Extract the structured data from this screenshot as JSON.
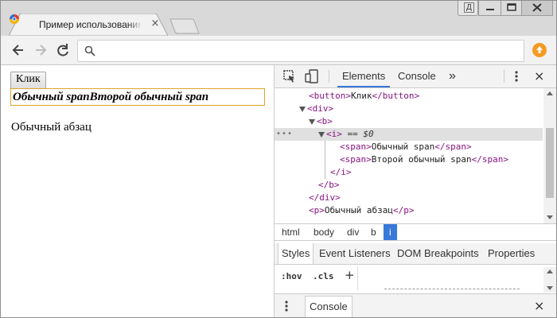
{
  "browser": {
    "tab_title": "Пример использования jQuery",
    "tab_close": "×",
    "omnibox_value": "",
    "user_badge": "Д"
  },
  "page": {
    "button_label": "Клик",
    "b_text": "Обычный spanВторой обычный span",
    "p_text": "Обычный абзац"
  },
  "devtools": {
    "tabs": [
      "Elements",
      "Console"
    ],
    "more": "»",
    "close": "×",
    "dom_lines": [
      {
        "open": "<button>",
        "text": "Клик",
        "close": "</button>"
      },
      {
        "open": "<div>",
        "text": "",
        "close": ""
      },
      {
        "open": "<b>",
        "text": "",
        "close": ""
      },
      {
        "open": "<i>",
        "text": "",
        "close": ""
      },
      {
        "open": "<span>",
        "text": "Обычный span",
        "close": "</span>"
      },
      {
        "open": "<span>",
        "text": "Второй обычный span",
        "close": "</span>"
      },
      {
        "open": "",
        "text": "",
        "close": "</i>"
      },
      {
        "open": "",
        "text": "",
        "close": "</b>"
      },
      {
        "open": "",
        "text": "",
        "close": "</div>"
      },
      {
        "open": "<p>",
        "text": "Обычный абзац",
        "close": "</p>"
      }
    ],
    "selected_marker": "== $0",
    "dots": "•••",
    "breadcrumbs": [
      "html",
      "body",
      "div",
      "b",
      "i"
    ],
    "subtabs": [
      "Styles",
      "Event Listeners",
      "DOM Breakpoints",
      "Properties"
    ],
    "hov": ":hov",
    "cls": ".cls",
    "plus": "+",
    "drawer_tab": "Console"
  }
}
